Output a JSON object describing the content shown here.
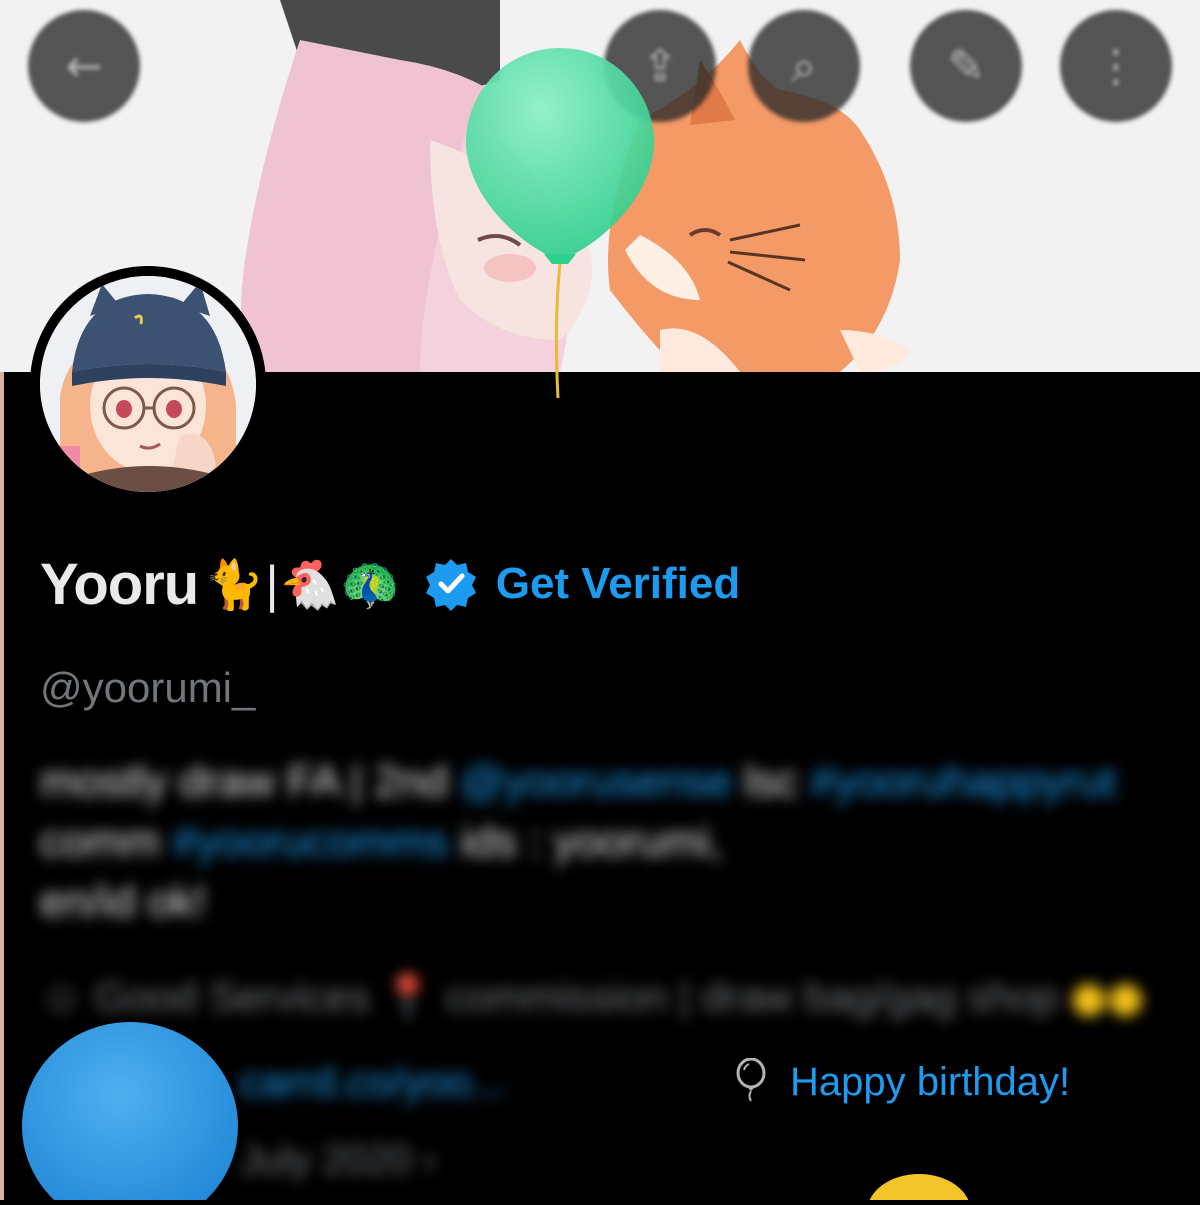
{
  "header": {
    "back_icon": "arrow-left-icon",
    "icons": [
      "share-icon",
      "search-icon",
      "edit-icon",
      "more-icon"
    ]
  },
  "profile": {
    "display_name": "Yooru",
    "name_emojis": "🐈|🐔🦚",
    "verified_badge_icon": "verified-badge-icon",
    "get_verified_label": "Get Verified",
    "handle": "@yoorumi_",
    "bio_text_1": "mostly draw FA | 2nd",
    "bio_link_1": "@yoorusense",
    "bio_text_2": "lsc",
    "bio_link_2": "#yooruhappyrut",
    "bio_text_3": "comm",
    "bio_link_3": "#yoorucomms",
    "bio_text_4": "ids : yoorumi,",
    "bio_text_5": "en/id ok!",
    "meta_text": "☺ Good Services   📍 commission | draw bag/gag shop",
    "meta_emoji": "●●",
    "url_text": "carrd.co/yoo...",
    "joined_text": "July 2020  ›",
    "birthday_label": "Happy birthday!",
    "birthday_icon": "balloon-icon"
  },
  "colors": {
    "accent": "#1d9bf0",
    "background": "#000000",
    "text_primary": "#e7e9ea",
    "text_secondary": "#71767b",
    "green_balloon": "#3fd69a",
    "blue_balloon": "#2b9ae6",
    "yellow_balloon": "#f2c629"
  }
}
